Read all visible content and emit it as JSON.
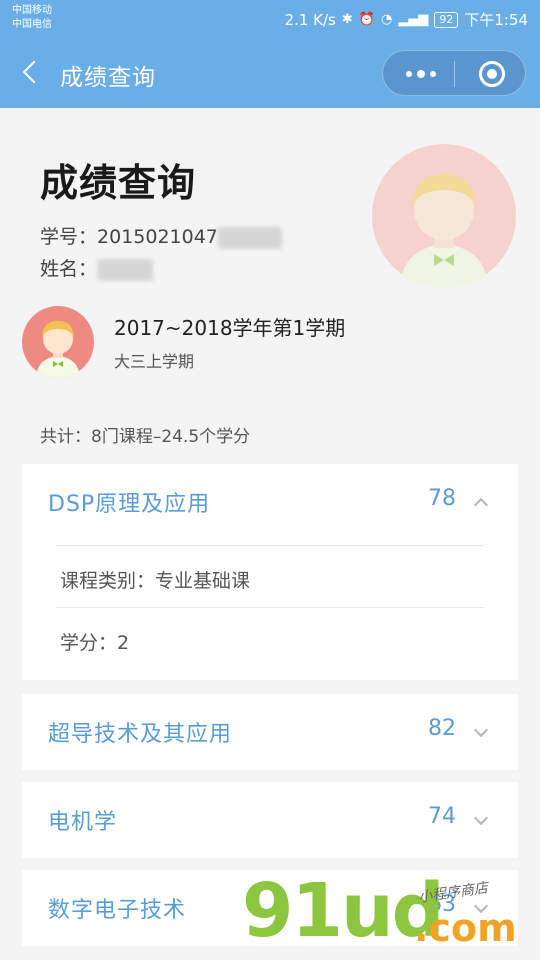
{
  "status_bar": {
    "carrier_1": "中国移动",
    "carrier_2": "中国电信",
    "speed": "2.1 K/s",
    "battery": "92",
    "time": "下午1:54"
  },
  "navbar": {
    "title": "成绩查询"
  },
  "profile": {
    "page_title": "成绩查询",
    "student_id_label": "学号：",
    "student_id_value": "2015021047",
    "name_label": "姓名："
  },
  "term": {
    "title": "2017~2018学年第1学期",
    "subtitle": "大三上学期"
  },
  "summary": "共计：8门课程–24.5个学分",
  "courses": [
    {
      "name": "DSP原理及应用",
      "score": "78",
      "expanded": true,
      "category_label": "课程类别：",
      "category": "专业基础课",
      "credit_label": "学分：",
      "credit": "2"
    },
    {
      "name": "超导技术及其应用",
      "score": "82",
      "expanded": false
    },
    {
      "name": "电机学",
      "score": "74",
      "expanded": false
    },
    {
      "name": "数字电子技术",
      "score": "63",
      "expanded": false
    }
  ],
  "watermark": {
    "brand": "91ud",
    "suffix": ".com",
    "tagline": "小程序商店"
  },
  "colors": {
    "accent": "#6aaee8",
    "course_text": "#5a9cd6"
  }
}
